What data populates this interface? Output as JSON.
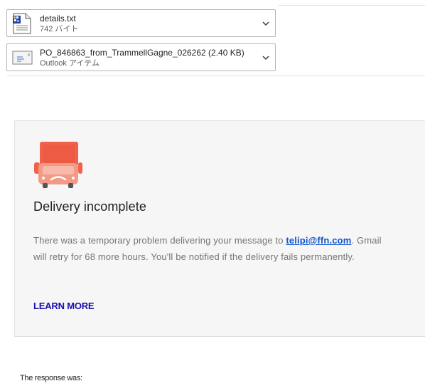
{
  "attachments": [
    {
      "name": "details.txt",
      "meta": "742 バイト",
      "icon": "text-file-icon"
    },
    {
      "name": "PO_846863_from_TrammellGagne_026262 (2.40 KB)",
      "meta": "Outlook アイテム",
      "icon": "envelope-icon"
    }
  ],
  "card": {
    "title": "Delivery incomplete",
    "body_before": "There was a temporary problem delivering your message to ",
    "email": "telipi@ffn.com",
    "body_after": ". Gmail will retry for 68 more hours. You'll be notified if the delivery fails permanently.",
    "learn_more": "LEARN MORE",
    "truck_icon": "delivery-truck-sad-icon",
    "colors": {
      "truck": "#f0624d",
      "background": "#f6f6f6",
      "link": "#1155cc"
    }
  },
  "response_label": "The response was:"
}
